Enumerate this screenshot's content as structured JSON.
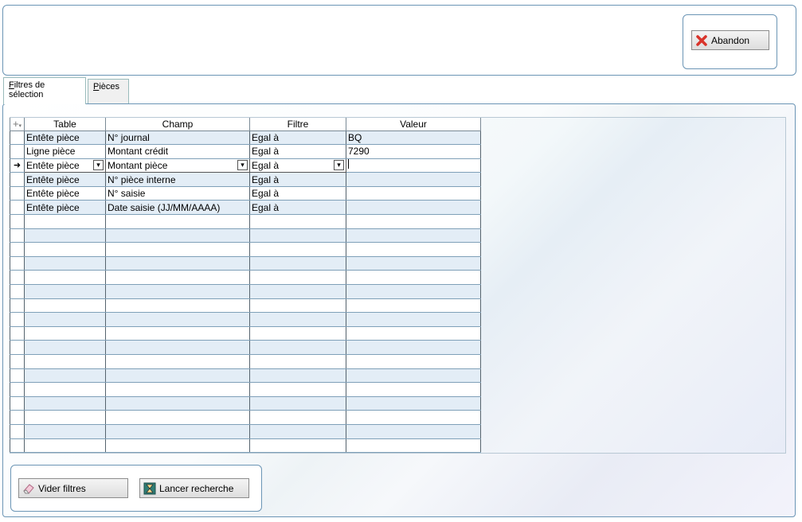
{
  "header": {
    "abandon_label": "Abandon"
  },
  "tabs": [
    {
      "label": "Filtres de sélection",
      "accel": "F",
      "rest": "iltres de sélection"
    },
    {
      "label": "Pièces",
      "accel": "P",
      "rest": "ièces"
    }
  ],
  "grid": {
    "columns": [
      "Table",
      "Champ",
      "Filtre",
      "Valeur"
    ],
    "rows": [
      {
        "table": "Entête pièce",
        "champ": "N° journal",
        "filtre": "Egal à",
        "valeur": "BQ"
      },
      {
        "table": "Ligne pièce",
        "champ": "Montant crédit",
        "filtre": "Egal à",
        "valeur": "7290"
      },
      {
        "table": "Entête pièce",
        "champ": "Montant pièce",
        "filtre": "Egal à",
        "valeur": ""
      },
      {
        "table": "Entête pièce",
        "champ": "N° pièce interne",
        "filtre": "Egal à",
        "valeur": ""
      },
      {
        "table": "Entête pièce",
        "champ": "N° saisie",
        "filtre": "Egal à",
        "valeur": ""
      },
      {
        "table": "Entête pièce",
        "champ": "Date saisie (JJ/MM/AAAA)",
        "filtre": "Egal à",
        "valeur": ""
      }
    ],
    "current_row_marker": "➜"
  },
  "footer": {
    "clear_label": "Vider filtres",
    "search_label": "Lancer recherche"
  },
  "colors": {
    "border": "#6b95b5",
    "alt_row": "#e3edf6",
    "close_red": "#d9342b"
  }
}
